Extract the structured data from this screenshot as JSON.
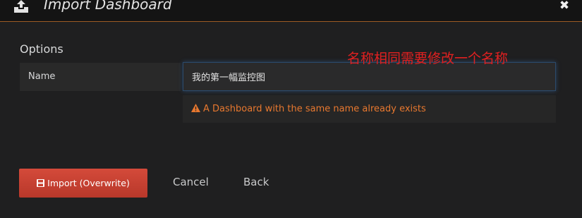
{
  "header": {
    "title": "Import Dashboard",
    "icon": "upload-icon",
    "close_label": "✖",
    "border_color": "#9c5b24"
  },
  "options": {
    "section_title": "Options",
    "name_label": "Name",
    "name_value": "我的第一幅监控图",
    "warning_text": "A Dashboard with the same name already exists",
    "warning_color": "#e8782f"
  },
  "annotation": {
    "text": "名称相同需要修改一个名称",
    "color": "#e02020"
  },
  "actions": {
    "import_label": "Import (Overwrite)",
    "import_icon": "save-icon",
    "import_color": "#c9402f",
    "cancel_label": "Cancel",
    "back_label": "Back"
  }
}
